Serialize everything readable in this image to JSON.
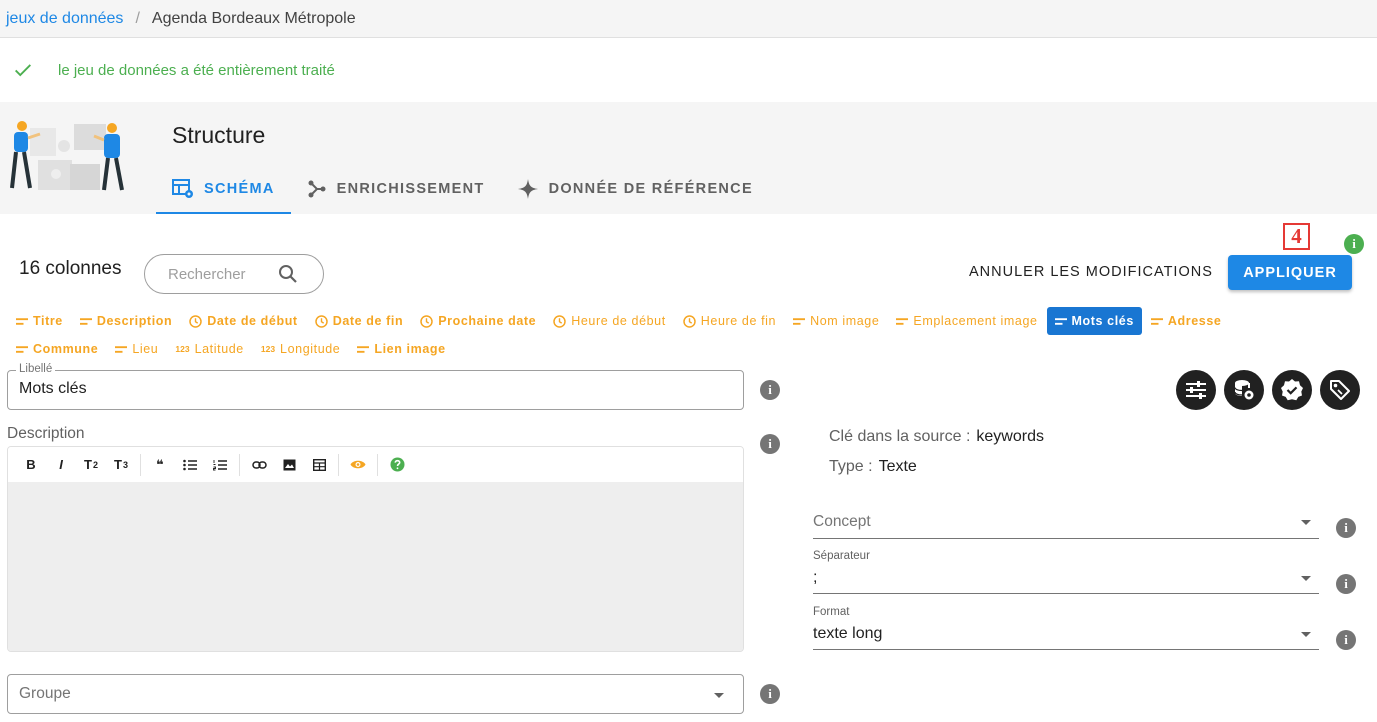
{
  "breadcrumb": {
    "parent": "jeux de données",
    "separator": "/",
    "current": "Agenda Bordeaux Métropole"
  },
  "alert": {
    "message": "le jeu de données a été entièrement traité",
    "icon": "check-icon",
    "color": "#4caf50"
  },
  "header": {
    "title": "Structure",
    "tabs": [
      {
        "label": "SCHÉMA",
        "icon": "schema-table-icon",
        "active": true
      },
      {
        "label": "ENRICHISSEMENT",
        "icon": "graph-nodes-icon",
        "active": false
      },
      {
        "label": "DONNÉE DE RÉFÉRENCE",
        "icon": "sparkle-icon",
        "active": false
      }
    ]
  },
  "toolbar": {
    "column_count": "16 colonnes",
    "search_placeholder": "Rechercher",
    "cancel_label": "ANNULER LES MODIFICATIONS",
    "apply_label": "APPLIQUER",
    "step_badge": "4",
    "info_glyph": "i"
  },
  "chips": [
    {
      "label": "Titre",
      "icon": "text-icon",
      "bold": true,
      "selected": false
    },
    {
      "label": "Description",
      "icon": "text-icon",
      "bold": true,
      "selected": false
    },
    {
      "label": "Date de début",
      "icon": "clock-icon",
      "bold": true,
      "selected": false
    },
    {
      "label": "Date de fin",
      "icon": "clock-icon",
      "bold": true,
      "selected": false
    },
    {
      "label": "Prochaine date",
      "icon": "clock-icon",
      "bold": true,
      "selected": false
    },
    {
      "label": "Heure de début",
      "icon": "clock-icon",
      "bold": false,
      "selected": false
    },
    {
      "label": "Heure de fin",
      "icon": "clock-icon",
      "bold": false,
      "selected": false
    },
    {
      "label": "Nom image",
      "icon": "text-icon",
      "bold": false,
      "selected": false
    },
    {
      "label": "Emplacement image",
      "icon": "text-icon",
      "bold": false,
      "selected": false
    },
    {
      "label": "Mots clés",
      "icon": "text-icon",
      "bold": true,
      "selected": true
    },
    {
      "label": "Adresse",
      "icon": "text-icon",
      "bold": true,
      "selected": false
    },
    {
      "label": "Commune",
      "icon": "text-icon",
      "bold": true,
      "selected": false
    },
    {
      "label": "Lieu",
      "icon": "text-icon",
      "bold": false,
      "selected": false
    },
    {
      "label": "Latitude",
      "icon": "number-icon",
      "icon_text": "123",
      "bold": false,
      "selected": false
    },
    {
      "label": "Longitude",
      "icon": "number-icon",
      "icon_text": "123",
      "bold": false,
      "selected": false
    },
    {
      "label": "Lien image",
      "icon": "text-icon",
      "bold": true,
      "selected": false
    }
  ],
  "form": {
    "libelle_legend": "Libellé",
    "libelle_value": "Mots clés",
    "description_label": "Description",
    "editor_buttons": {
      "bold": "B",
      "italic": "I",
      "h2": "T",
      "h2_sub": "2",
      "h3": "T",
      "h3_sub": "3",
      "quote": "❝"
    },
    "groupe_label": "Groupe"
  },
  "details": {
    "source_key_label": "Clé dans la source :",
    "source_key_value": "keywords",
    "type_label": "Type :",
    "type_value": "Texte",
    "concept_label": "Concept",
    "separator_label": "Séparateur",
    "separator_value": ";",
    "format_label": "Format",
    "format_value": "texte long"
  },
  "colors": {
    "accent": "#1e88e5",
    "chip": "#f5a623",
    "success": "#4caf50",
    "badge": "#e53935"
  }
}
